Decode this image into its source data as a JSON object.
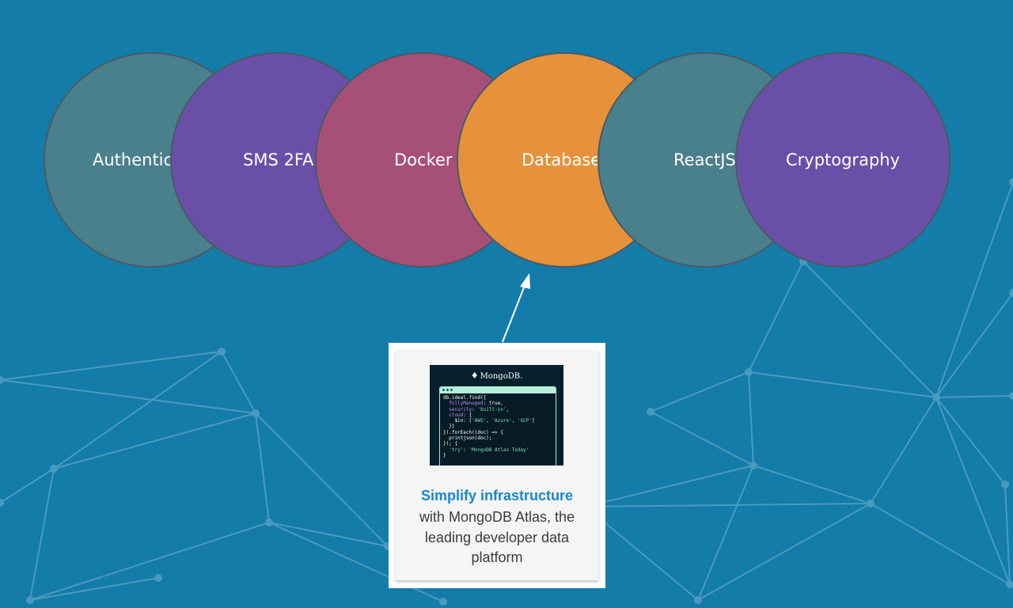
{
  "bubbles": [
    {
      "label": "Authentic",
      "color": "#4a7f8c"
    },
    {
      "label": "SMS 2FA",
      "color": "#6a4fa8"
    },
    {
      "label": "Docker",
      "color": "#a64f78"
    },
    {
      "label": "Database",
      "color": "#e6923a"
    },
    {
      "label": "ReactJS",
      "color": "#4a7f8c"
    },
    {
      "label": "Cryptography",
      "color": "#6a4fa8"
    }
  ],
  "ad": {
    "brand": "MongoDB.",
    "code_lines": [
      [
        {
          "t": "db.ideal.find({"
        }
      ],
      [
        {
          "t": "  fullyManaged",
          "c": "k"
        },
        {
          "t": ": true,"
        }
      ],
      [
        {
          "t": "  security",
          "c": "k"
        },
        {
          "t": ": "
        },
        {
          "t": "'built-in'",
          "c": "s"
        },
        {
          "t": ","
        }
      ],
      [
        {
          "t": "  cloud",
          "c": "k"
        },
        {
          "t": ": {"
        }
      ],
      [
        {
          "t": "    $in: ["
        },
        {
          "t": "'AWS'",
          "c": "s"
        },
        {
          "t": ", "
        },
        {
          "t": "'Azure'",
          "c": "s"
        },
        {
          "t": ", "
        },
        {
          "t": "'GCP'",
          "c": "s"
        },
        {
          "t": "]"
        }
      ],
      [
        {
          "t": "  }}"
        }
      ],
      [
        {
          "t": "}).forEach((doc) => {"
        }
      ],
      [
        {
          "t": "  printjson(doc);"
        }
      ],
      [
        {
          "t": "}); {"
        }
      ],
      [
        {
          "t": "  "
        },
        {
          "t": "'try'",
          "c": "s"
        },
        {
          "t": ": "
        },
        {
          "t": "'MongoDB Atlas Today'",
          "c": "s"
        }
      ],
      [
        {
          "t": "}"
        }
      ]
    ],
    "title": "Simplify infrastructure",
    "body": "with MongoDB Atlas, the leading developer data platform"
  },
  "colors": {
    "background": "#137ca8",
    "link": "#1987d1"
  }
}
